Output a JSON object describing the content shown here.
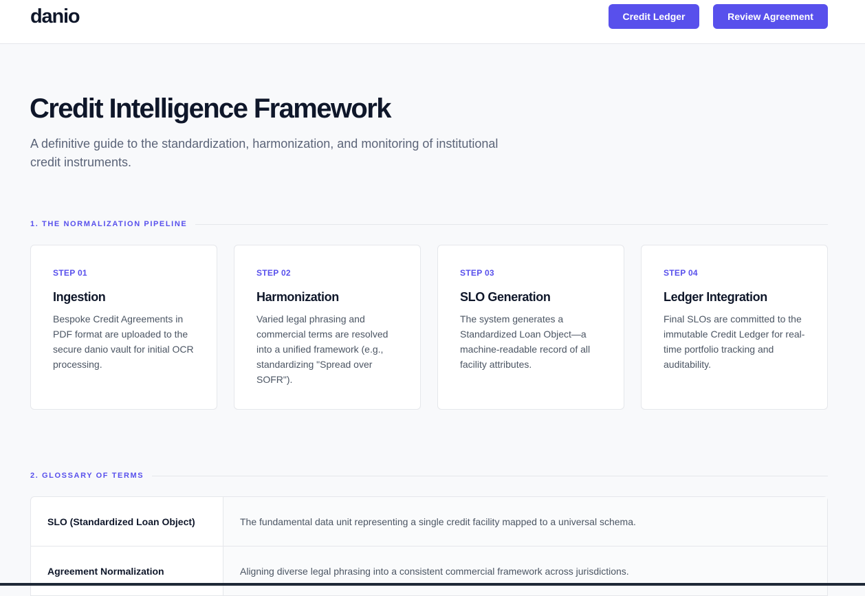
{
  "header": {
    "logo": "danio",
    "buttons": {
      "ledger": "Credit Ledger",
      "review": "Review Agreement"
    }
  },
  "hero": {
    "title": "Credit Intelligence Framework",
    "subtitle": "A definitive guide to the standardization, harmonization, and monitoring of institutional credit instruments."
  },
  "pipeline": {
    "heading": "1. THE NORMALIZATION PIPELINE",
    "steps": [
      {
        "step": "STEP 01",
        "title": "Ingestion",
        "description": "Bespoke Credit Agreements in PDF format are uploaded to the secure danio vault for initial OCR processing."
      },
      {
        "step": "STEP 02",
        "title": "Harmonization",
        "description": "Varied legal phrasing and commercial terms are resolved into a unified framework (e.g., standardizing \"Spread over SOFR\")."
      },
      {
        "step": "STEP 03",
        "title": "SLO Generation",
        "description": "The system generates a Standardized Loan Object—a machine-readable record of all facility attributes."
      },
      {
        "step": "STEP 04",
        "title": "Ledger Integration",
        "description": "Final SLOs are committed to the immutable Credit Ledger for real-time portfolio tracking and auditability."
      }
    ]
  },
  "glossary": {
    "heading": "2. GLOSSARY OF TERMS",
    "rows": [
      {
        "term": "SLO (Standardized Loan Object)",
        "definition": "The fundamental data unit representing a single credit facility mapped to a universal schema."
      },
      {
        "term": "Agreement Normalization",
        "definition": "Aligning diverse legal phrasing into a consistent commercial framework across jurisdictions."
      }
    ]
  },
  "colors": {
    "accent": "#5850ec",
    "text": "#0f172a",
    "muted": "#5b6478",
    "border": "#e5e7eb",
    "background": "#f8f9fb"
  }
}
